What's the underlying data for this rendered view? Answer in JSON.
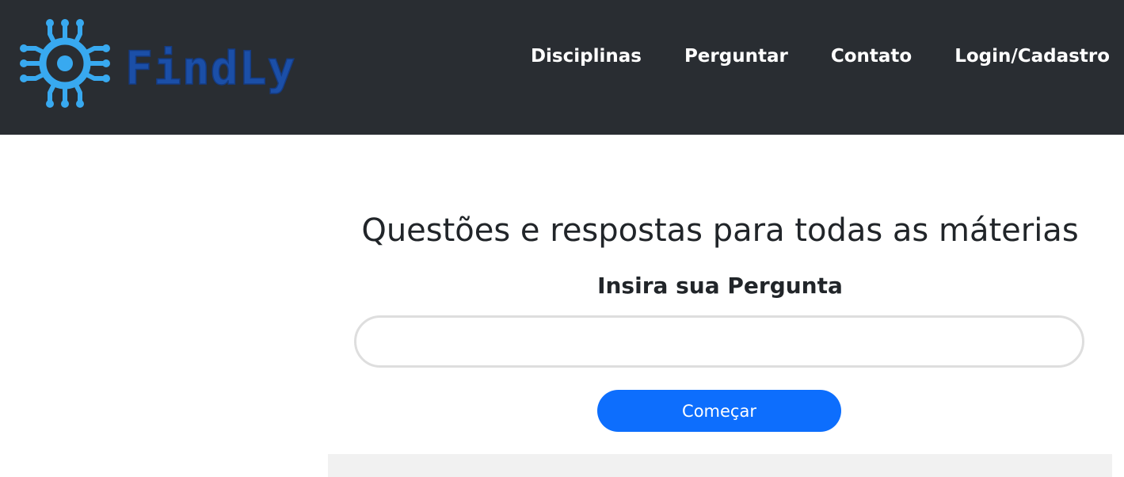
{
  "brand": {
    "name": "FindLy",
    "logo_icon": "circuit-sun-icon",
    "logo_color": "#38a9f0",
    "name_color": "#1b4fa8"
  },
  "nav": {
    "background": "#292d32",
    "links": [
      {
        "label": "Disciplinas"
      },
      {
        "label": "Perguntar"
      },
      {
        "label": "Contato"
      },
      {
        "label": "Login/Cadastro"
      }
    ]
  },
  "hero": {
    "title": "Questões e respostas para todas as máterias",
    "subtitle": "Insira sua Pergunta",
    "input": {
      "value": "",
      "placeholder": ""
    },
    "button_label": "Começar",
    "button_color": "#0d6efd"
  }
}
